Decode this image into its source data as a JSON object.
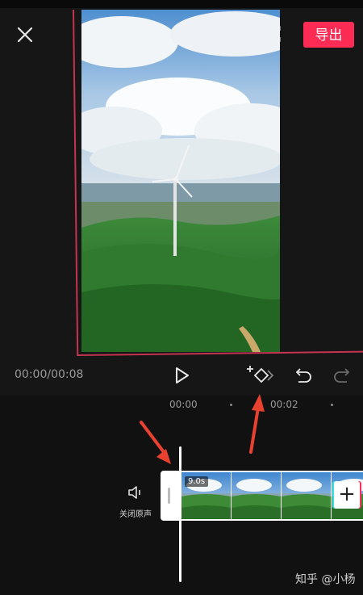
{
  "header": {
    "export_label": "导出",
    "close_icon": "close-icon",
    "fullscreen_icon": "fullscreen-icon"
  },
  "player": {
    "time_display": "00:00/00:08",
    "controls": [
      "play-icon",
      "add-keyframe-icon",
      "undo-icon",
      "redo-icon"
    ]
  },
  "timeline": {
    "ticks": [
      "00:00",
      "00:02"
    ],
    "mute_label": "关闭原声",
    "clip_duration": "9.0s",
    "add_clip_label": "+"
  },
  "annotations": {
    "arrow_color": "#e8412f"
  },
  "watermark": "知乎 @小杨",
  "colors": {
    "accent": "#fe2c55",
    "background": "#111111",
    "panel": "#161616",
    "preview_outline": "#c2344f"
  }
}
